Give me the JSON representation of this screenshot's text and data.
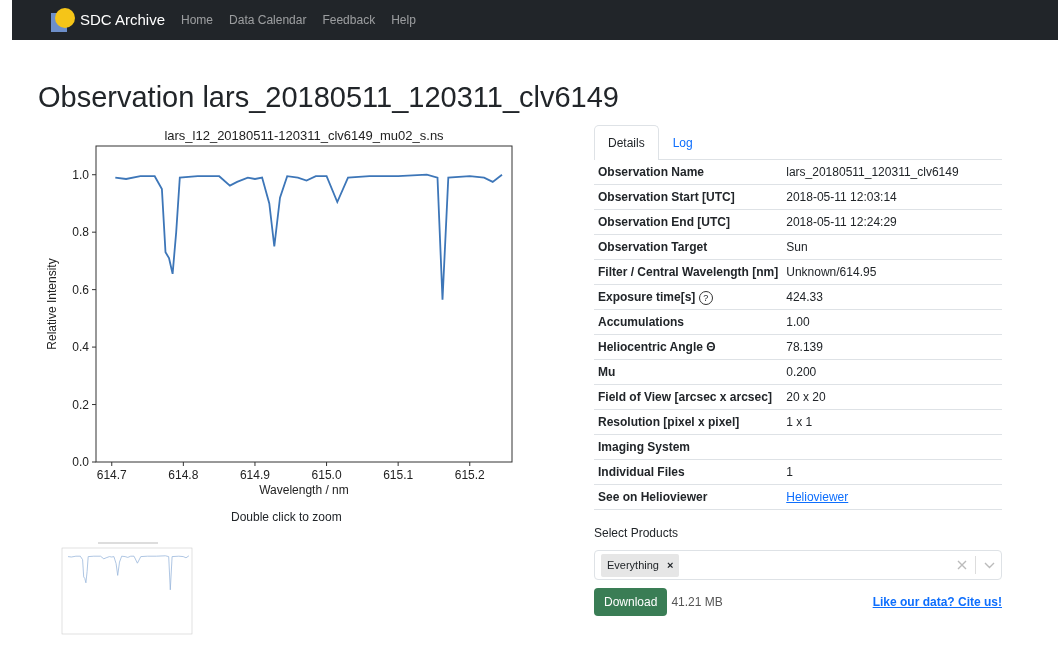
{
  "navbar": {
    "brand": "SDC Archive",
    "links": [
      {
        "label": "Home"
      },
      {
        "label": "Data Calendar"
      },
      {
        "label": "Feedback"
      },
      {
        "label": "Help"
      }
    ]
  },
  "page_title": "Observation lars_20180511_120311_clv6149",
  "plot": {
    "caption": "Double click to zoom",
    "chart_data": {
      "type": "line",
      "title": "lars_l12_20180511-120311_clv6149_mu02_s.ns",
      "xlabel": "Wavelength / nm",
      "ylabel": "Relative Intensity",
      "x": [
        614.705,
        614.72,
        614.74,
        614.76,
        614.77,
        614.775,
        614.78,
        614.785,
        614.79,
        614.795,
        614.82,
        614.85,
        614.865,
        614.875,
        614.89,
        614.9,
        614.91,
        614.92,
        614.927,
        614.935,
        614.945,
        614.96,
        614.972,
        614.985,
        615.0,
        615.015,
        615.03,
        615.06,
        615.1,
        615.14,
        615.155,
        615.162,
        615.17,
        615.2,
        615.22,
        615.232,
        615.245
      ],
      "series": [
        {
          "color": "#3d76b8",
          "values": [
            0.99,
            0.985,
            0.995,
            0.995,
            0.95,
            0.73,
            0.71,
            0.655,
            0.8,
            0.99,
            0.995,
            0.995,
            0.962,
            0.975,
            0.99,
            0.985,
            0.99,
            0.9,
            0.75,
            0.92,
            0.995,
            0.99,
            0.98,
            0.995,
            0.995,
            0.905,
            0.99,
            0.995,
            0.995,
            1.0,
            0.99,
            0.565,
            0.99,
            0.995,
            0.99,
            0.975,
            1.0
          ]
        }
      ],
      "xlim": [
        614.678,
        615.259
      ],
      "ylim": [
        0,
        1.1
      ],
      "xticks": [
        {
          "value": 614.7,
          "label": "614.7"
        },
        {
          "value": 614.8,
          "label": "614.8"
        },
        {
          "value": 614.9,
          "label": "614.9"
        },
        {
          "value": 615.0,
          "label": "615.0"
        },
        {
          "value": 615.1,
          "label": "615.1"
        },
        {
          "value": 615.2,
          "label": "615.2"
        }
      ],
      "yticks": [
        {
          "value": 0,
          "label": "0.0"
        },
        {
          "value": 0.2,
          "label": "0.2"
        },
        {
          "value": 0.4,
          "label": "0.4"
        },
        {
          "value": 0.6,
          "label": "0.6"
        },
        {
          "value": 0.8,
          "label": "0.8"
        },
        {
          "value": 1.0,
          "label": "1.0"
        }
      ]
    }
  },
  "tabs": [
    {
      "label": "Details",
      "selected": true
    },
    {
      "label": "Log",
      "selected": false
    }
  ],
  "details": [
    {
      "label": "Observation Name",
      "value": "lars_20180511_120311_clv6149"
    },
    {
      "label": "Observation Start [UTC]",
      "value": "2018-05-11 12:03:14"
    },
    {
      "label": "Observation End [UTC]",
      "value": "2018-05-11 12:24:29"
    },
    {
      "label": "Observation Target",
      "value": "Sun"
    },
    {
      "label": "Filter / Central Wavelength [nm]",
      "value": "Unknown/614.95"
    },
    {
      "label": "Exposure time[s]",
      "help": "?",
      "value": "424.33"
    },
    {
      "label": "Accumulations",
      "value": "1.00"
    },
    {
      "label": "Heliocentric Angle Θ",
      "value": "78.139"
    },
    {
      "label": "Mu",
      "value": "0.200"
    },
    {
      "label": "Field of View [arcsec x arcsec]",
      "value": "20 x 20"
    },
    {
      "label": "Resolution [pixel x pixel]",
      "value": "1 x 1"
    },
    {
      "label": "Imaging System"
    },
    {
      "label": "Individual Files",
      "value": "1"
    },
    {
      "label": "See on Helioviewer",
      "value": "Helioviewer",
      "kind": "link"
    }
  ],
  "products": {
    "label": "Select Products",
    "tags": [
      {
        "label": "Everything",
        "remove": "×"
      }
    ]
  },
  "download": {
    "button": "Download",
    "size": "41.21 MB"
  },
  "cite_link": "Like our data? Cite us!"
}
